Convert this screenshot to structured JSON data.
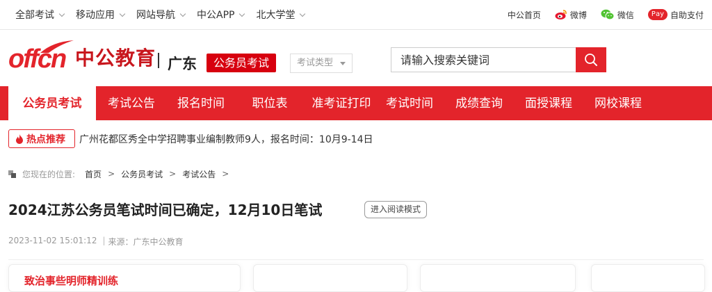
{
  "topbar": {
    "nav": [
      {
        "label": "全部考试"
      },
      {
        "label": "移动应用"
      },
      {
        "label": "网站导航"
      },
      {
        "label": "中公APP"
      },
      {
        "label": "北大学堂"
      }
    ],
    "links": {
      "home": "中公首页",
      "weibo": "微博",
      "wechat": "微信",
      "pay_badge": "Pay",
      "pay": "自助支付"
    }
  },
  "header": {
    "brand_en": "offcn",
    "brand_cn": "中公教育",
    "region": "广东",
    "exam_tag": "公务员考试",
    "exam_type": "考试类型",
    "search_placeholder": "请输入搜索关键词"
  },
  "mainnav": [
    {
      "label": "公务员考试"
    },
    {
      "label": "考试公告"
    },
    {
      "label": "报名时间"
    },
    {
      "label": "职位表"
    },
    {
      "label": "准考证打印"
    },
    {
      "label": "考试时间"
    },
    {
      "label": "成绩查询"
    },
    {
      "label": "面授课程"
    },
    {
      "label": "网校课程"
    }
  ],
  "hot": {
    "badge": "热点推荐",
    "text": "广州花都区秀全中学招聘事业编制教师9人，报名时间：10月9-14日"
  },
  "breadcrumb": {
    "here": "您现在的位置:",
    "items": [
      "首页",
      "公务员考试",
      "考试公告"
    ],
    "sep": ">"
  },
  "article": {
    "title": "2024江苏公务员笔试时间已确定，12月10日笔试",
    "read_mode": "进入阅读模式",
    "date": "2023-11-02 15:01:12",
    "source": "来源：广东中公教育"
  },
  "cards": {
    "first_peek": "致治事些明师精训练"
  },
  "colors": {
    "brand_red": "#e3242b",
    "tag_red": "#d7000f"
  }
}
